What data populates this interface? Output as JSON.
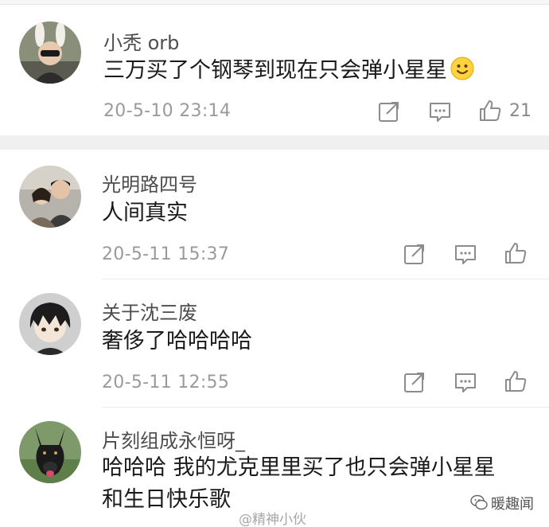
{
  "comments": [
    {
      "username": "小秃 orb",
      "text": "三万买了个钢琴到现在只会弹小星星",
      "time": "20-5-10 23:14",
      "likes": "21"
    },
    {
      "username": "光明路四号",
      "text": "人间真实",
      "time": "20-5-11 15:37",
      "likes": ""
    },
    {
      "username": "关于沈三废",
      "text": "奢侈了哈哈哈哈",
      "time": "20-5-11 12:55",
      "likes": ""
    },
    {
      "username": "片刻组成永恒呀_",
      "text_line1": "哈哈哈 我的尤克里里买了也只会弹小星星",
      "text_line2": "和生日快乐歌"
    }
  ],
  "watermark": "@精神小伙",
  "brand": "暖趣闻",
  "icons": {
    "share": "share-icon",
    "comment": "comment-icon",
    "like": "thumbs-up-icon",
    "emoji": "smiley-icon"
  },
  "colors": {
    "username": "#4d4d4d",
    "time": "#9a9a9a",
    "separator": "#f0f0f0"
  }
}
